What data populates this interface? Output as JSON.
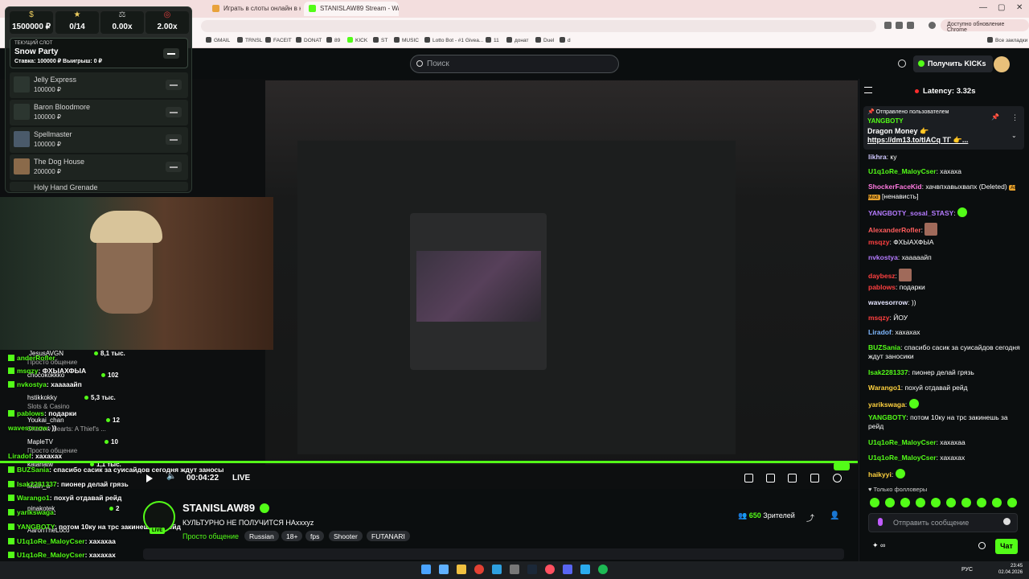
{
  "browser": {
    "tabs": [
      {
        "label": "Играть в слоты онлайн в казино"
      },
      {
        "label": "STANISLAW89 Stream - Watch Live on Kick"
      }
    ],
    "update_button": "Доступно обновление Chrome",
    "all_bookmarks": "Все закладки",
    "bookmarks": [
      "GMAIL",
      "TRNSL",
      "FACEIT",
      "DONAT",
      "89",
      "KICK",
      "ST",
      "MUSIC",
      "Lotto Bot - #1 Givea...",
      "11",
      "донат",
      "Duel",
      "d"
    ]
  },
  "kick_header": {
    "search_placeholder": "Поиск",
    "get_kicks": "Получить KICKs"
  },
  "slot_panel": {
    "stats": [
      "1500000 ₽",
      "0/14",
      "0.00x",
      "2.00x"
    ],
    "current": {
      "label": "ТЕКУЩИЙ СЛОТ",
      "name": "Snow Party",
      "meta": "Ставка: 100000 ₽   Выигрыш: 0 ₽"
    },
    "items": [
      {
        "name": "Jelly Express",
        "price": "100000 ₽"
      },
      {
        "name": "Baron Bloodmore",
        "price": "100000 ₽"
      },
      {
        "name": "Spellmaster",
        "price": "100000 ₽"
      },
      {
        "name": "The Dog House",
        "price": "200000 ₽"
      },
      {
        "name": "Holy Hand Grenade",
        "price": ""
      }
    ]
  },
  "overlay_chat": [
    {
      "user": "anderRofler",
      "text": ""
    },
    {
      "user": "msqzy",
      "text": "ФХЫАХФЫА"
    },
    {
      "user": "nvkostya",
      "text": "хааааайп"
    },
    {
      "user": "pablows",
      "text": "подарки"
    },
    {
      "user": "wavesorrow",
      "text": "))"
    },
    {
      "user": "Liradof",
      "text": "хахахах"
    },
    {
      "user": "BUZSania",
      "text": "спасибо сасик за суисайдов сегодня ждут заносы"
    },
    {
      "user": "Isak2281337",
      "text": "пионер делай грязь"
    },
    {
      "user": "Warango1",
      "text": "похуй отдавай рейд"
    },
    {
      "user": "yarikswaga",
      "text": ""
    },
    {
      "user": "YANGBOTY",
      "text": "потом 10ку на трс закинешь за рейд"
    },
    {
      "user": "U1q1oRe_MaloyCser",
      "text": "хахахаа"
    },
    {
      "user": "U1q1oRe_MaloyCser",
      "text": "хахахаx"
    },
    {
      "user": "haikyyi",
      "text": ""
    }
  ],
  "recommended": [
    {
      "name": "JesusAVGN",
      "sub": "Просто общение",
      "count": "8,1 тыс."
    },
    {
      "name": "chocokokkko",
      "sub": "",
      "count": "102"
    },
    {
      "name": "hstikkokky",
      "sub": "Slots & Casino",
      "count": "5,3 тыс."
    },
    {
      "name": "Youkai_chan",
      "sub": "Shadow Hearts: A Thief's ...",
      "count": "12"
    },
    {
      "name": "MapleTV",
      "sub": "Просто общение",
      "count": "10"
    },
    {
      "name": "katanatw",
      "sub": "Slots & Casino",
      "count": "1,1 тыс."
    },
    {
      "name": "Malin_a",
      "sub": "",
      "count": "3"
    },
    {
      "name": "pinakotek",
      "sub": "Просто общение",
      "count": "2"
    },
    {
      "name": "AaronTheLoco",
      "sub": "",
      "count": "195"
    }
  ],
  "player": {
    "time": "00:04:22",
    "live_label": "LIVE"
  },
  "stream": {
    "channel": "STANISLAW89",
    "live_badge": "LIVE",
    "title": "КУЛЬТУРНО НЕ ПОЛУЧИТСЯ НАxxxyz",
    "category": "Просто общение",
    "tags": [
      "Russian",
      "18+",
      "fps",
      "Shooter",
      "FUTANARI"
    ],
    "viewers_count": "650",
    "viewers_label": "Зрителей"
  },
  "chat": {
    "latency": "Latency: 3.32s",
    "pinned": {
      "by": "Отправлено пользователем",
      "user": "YANGBOTY",
      "message": "Dragon Money 👉",
      "link": "https://dm13.to/tlACq",
      "suffix": "ТГ 👉..."
    },
    "messages": [
      {
        "user": "likhra",
        "color": "#d0c8ff",
        "text": "ку"
      },
      {
        "user": "U1q1oRe_MaloyCser",
        "color": "#53fc18",
        "text": "хахаха"
      },
      {
        "user": "ShockerFaceKid",
        "color": "#ff79e0",
        "text": "хачвпхавыхвапх (Deleted)"
      },
      {
        "user": "YANGBOTY_sosal_STASY",
        "color": "#b57bff",
        "text": ""
      },
      {
        "user": "AlexanderRofler",
        "color": "#ff5c5c",
        "text": ""
      },
      {
        "user": "msqzy",
        "color": "#ff4040",
        "text": "ФХЫАХФЫА"
      },
      {
        "user": "nvkostya",
        "color": "#b57bff",
        "text": "хааааайп"
      },
      {
        "user": "daybesz",
        "color": "#ff4040",
        "text": ""
      },
      {
        "user": "pablows",
        "color": "#ff4040",
        "text": "подарки"
      },
      {
        "user": "wavesorrow",
        "color": "#e6e6ff",
        "text": "))"
      },
      {
        "user": "msqzy",
        "color": "#ff4040",
        "text": "ЙОУ"
      },
      {
        "user": "Liradof",
        "color": "#7fb8ff",
        "text": "хахахах"
      },
      {
        "user": "BUZSania",
        "color": "#53fc18",
        "text": "спасибо сасик за суисайдов сегодня ждут заносики"
      },
      {
        "user": "Isak2281337",
        "color": "#53fc18",
        "text": "пионер делай грязь"
      },
      {
        "user": "Warango1",
        "color": "#ffd23f",
        "text": "похуй отдавай рейд"
      },
      {
        "user": "yarikswaga",
        "color": "#ffd23f",
        "text": ""
      },
      {
        "user": "YANGBOTY",
        "color": "#53fc18",
        "text": "потом 10ку на трс закинешь за рейд"
      },
      {
        "user": "U1q1oRe_MaloyCser",
        "color": "#53fc18",
        "text": "хахахаа"
      },
      {
        "user": "U1q1oRe_MaloyCser",
        "color": "#53fc18",
        "text": "хахахаx"
      },
      {
        "user": "haikyyi",
        "color": "#ffd23f",
        "text": ""
      }
    ],
    "shocker_extra": "AI Mod",
    "shocker_tail": "[ненависть]",
    "followers_only": "Только фолловеры",
    "input_placeholder": "Отправить сообщение",
    "send_button": "Чат"
  },
  "taskbar": {
    "lang": "РУС",
    "time": "23:45",
    "date": "02.04.2026"
  }
}
